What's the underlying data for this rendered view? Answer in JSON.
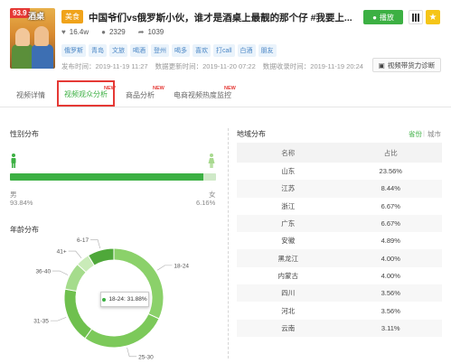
{
  "video": {
    "score": "93.9",
    "thumb_caption": "酒桌",
    "category": "美食",
    "title": "中国爷们vs俄罗斯小伙，谁才是酒桌上最靓的那个仔 #我要上...",
    "likes": "16.4w",
    "comments": "2329",
    "shares": "1039",
    "tags": [
      "俄罗斯",
      "青岛",
      "文旅",
      "喝酒",
      "登州",
      "喝多",
      "喜欢",
      "打call",
      "白酒",
      "朋友"
    ],
    "published": "发布时间：2019-11-19 11:27",
    "data_updated": "数据更新时间：2019-11-20 07:22",
    "data_collected": "数据收录时间：2019-11-19 20:24"
  },
  "actions": {
    "play_label": "播放",
    "diagnose_label": "视频带货力诊断"
  },
  "tabs": [
    {
      "label": "视频详情",
      "new": ""
    },
    {
      "label": "视频观众分析",
      "new": "NEW"
    },
    {
      "label": "商品分析",
      "new": "NEW"
    },
    {
      "label": "电商视频热度监控",
      "new": "NEW"
    }
  ],
  "gender": {
    "title": "性别分布",
    "male_label": "男",
    "male_pct": "93.84%",
    "female_label": "女",
    "female_pct": "6.16%",
    "male_value": 93.84,
    "colors": {
      "male": "#3cb043",
      "female": "#cfe9c8"
    }
  },
  "age": {
    "title": "年龄分布",
    "tooltip": "18-24: 31.88%"
  },
  "chart_data": {
    "type": "pie",
    "categories": [
      "18-24",
      "25-30",
      "31-35",
      "36-40",
      "41+",
      "6-17"
    ],
    "values": [
      31.88,
      28.0,
      18.0,
      9.0,
      4.5,
      8.62
    ],
    "colors": [
      "#8bd16a",
      "#7cc95a",
      "#6fc04e",
      "#a5dc8c",
      "#c9ebb8",
      "#4fa83a"
    ]
  },
  "region": {
    "title": "地域分布",
    "toggle_province": "省份",
    "toggle_city": "城市",
    "col_name": "名称",
    "col_share": "占比",
    "rows": [
      {
        "name": "山东",
        "share": "23.56%"
      },
      {
        "name": "江苏",
        "share": "8.44%"
      },
      {
        "name": "浙江",
        "share": "6.67%"
      },
      {
        "name": "广东",
        "share": "6.67%"
      },
      {
        "name": "安徽",
        "share": "4.89%"
      },
      {
        "name": "黑龙江",
        "share": "4.00%"
      },
      {
        "name": "内蒙古",
        "share": "4.00%"
      },
      {
        "name": "四川",
        "share": "3.56%"
      },
      {
        "name": "河北",
        "share": "3.56%"
      },
      {
        "name": "云南",
        "share": "3.11%"
      }
    ]
  }
}
